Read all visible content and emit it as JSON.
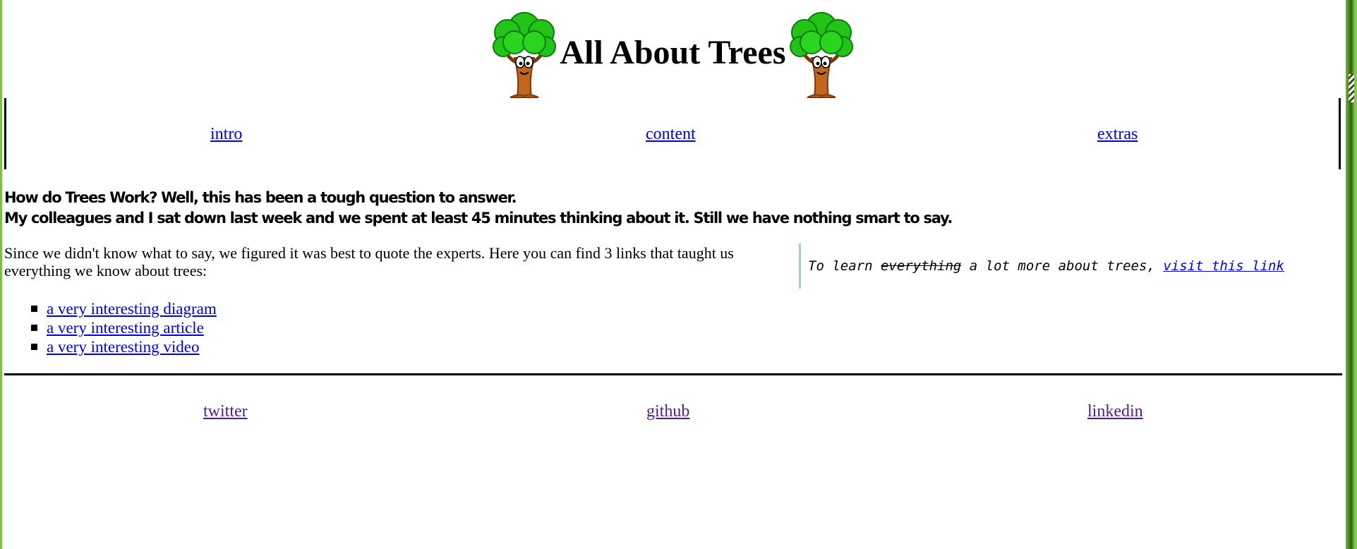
{
  "header": {
    "title": "All About Trees",
    "logo_icon": "cartoon-tree-icon",
    "colors": {
      "foliage": "#22c417",
      "foliage_dark": "#0f7a0a",
      "trunk": "#c4651e"
    }
  },
  "nav": {
    "items": [
      {
        "label": "intro"
      },
      {
        "label": "content"
      },
      {
        "label": "extras"
      }
    ]
  },
  "intro": {
    "heading_line1": "How do Trees Work? Well, this has been a tough question to answer.",
    "heading_line2": "My colleagues and I sat down last week and we spent at least 45 minutes thinking about it. Still we have nothing smart to say."
  },
  "content": {
    "paragraph": "Since we didn't know what to say, we figured it was best to quote the experts. Here you can find 3 links that taught us everything we know about trees:",
    "links": [
      {
        "label": "a very interesting diagram"
      },
      {
        "label": "a very interesting article"
      },
      {
        "label": "a very interesting video"
      }
    ]
  },
  "aside": {
    "prefix": "To learn ",
    "struck": "everything",
    "middle": " a lot more about trees, ",
    "link_label": "visit this link",
    "border_color": "#a9c6db"
  },
  "footer": {
    "items": [
      {
        "label": "twitter"
      },
      {
        "label": "github"
      },
      {
        "label": "linkedin"
      }
    ]
  },
  "colors": {
    "link": "#0000ee",
    "visited_link": "#551a8b",
    "window_edge": "#7cc242"
  }
}
